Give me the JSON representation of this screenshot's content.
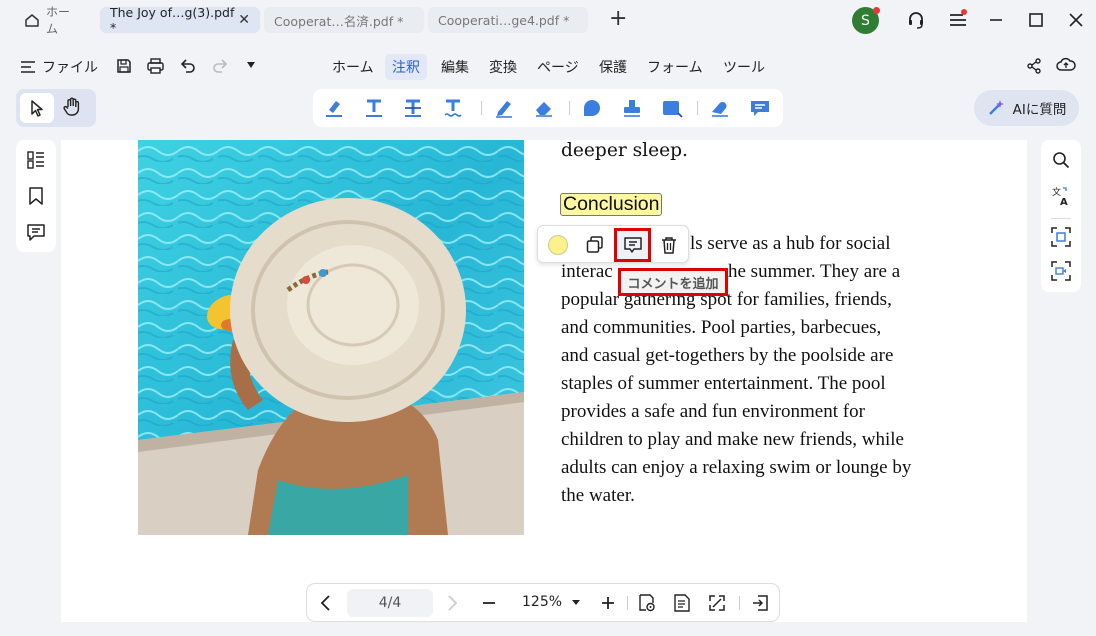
{
  "tabs": {
    "home": "ホーム",
    "items": [
      {
        "label": "The Joy of…g(3).pdf *",
        "close": "✕"
      },
      {
        "label": "Cooperat…名済.pdf *"
      },
      {
        "label": "Cooperati…ge4.pdf *"
      }
    ],
    "new_tab": "+"
  },
  "account": {
    "avatar_letter": "S",
    "avatar_color": "#2e7d32",
    "dot_color": "#e53935"
  },
  "file_menu": "ファイル",
  "menus": [
    "ホーム",
    "注釈",
    "編集",
    "変換",
    "ページ",
    "保護",
    "フォーム",
    "ツール"
  ],
  "active_menu": "注釈",
  "ai_button": "AIに質問",
  "document": {
    "top_line": "deeper sleep.",
    "heading": "Conclusion",
    "paragraph_lines": [
      "ls serve as a hub for social",
      "interac",
      "he summer. They are a",
      "popular gathering spot for families, friends,",
      "and communities. Pool parties, barbecues,",
      "and casual get-togethers by the poolside are",
      "staples of summer entertainment. The pool",
      "provides a safe and fun environment for",
      "children to play and make new friends, while",
      "adults can enjoy a relaxing swim or lounge by",
      "the water."
    ]
  },
  "popup": {
    "tooltip": "コメントを追加",
    "highlight_color": "#fdf18a"
  },
  "bottom": {
    "page": "4/4",
    "zoom": "125%"
  },
  "colors": {
    "accent": "#2b5ddb",
    "annotation_blue": "#3b7ee0",
    "highlight_red": "#e00000"
  }
}
